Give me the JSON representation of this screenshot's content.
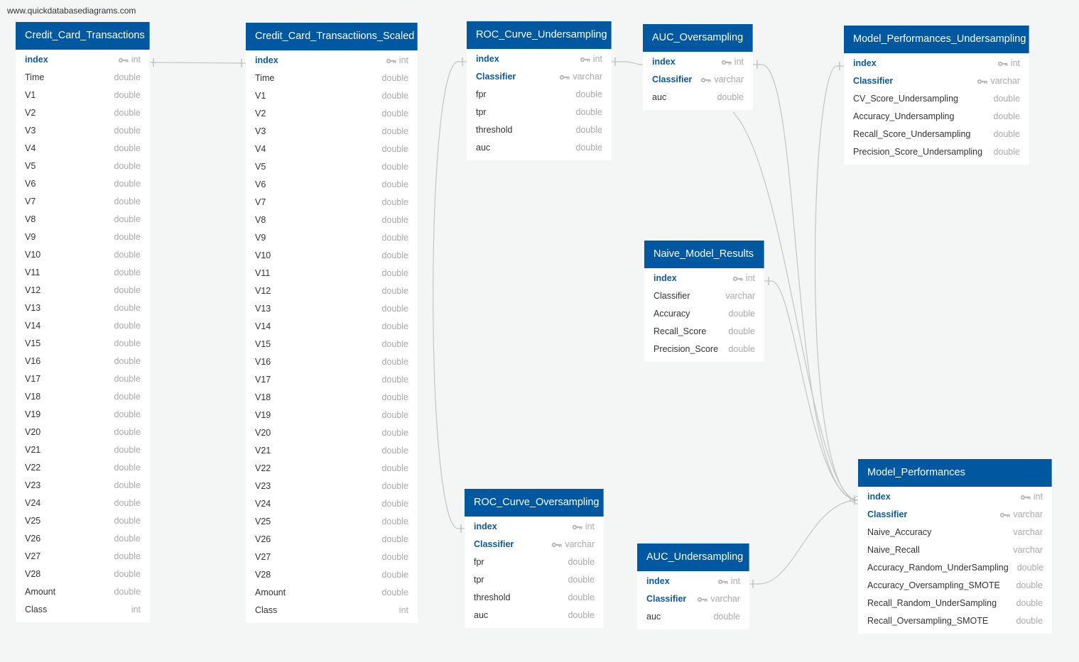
{
  "watermark": "www.quickdatabasediagrams.com",
  "tables": {
    "cct": {
      "name": "Credit_Card_Transactions",
      "fields": [
        {
          "name": "index",
          "type": "int",
          "pk": true
        },
        {
          "name": "Time",
          "type": "double"
        },
        {
          "name": "V1",
          "type": "double"
        },
        {
          "name": "V2",
          "type": "double"
        },
        {
          "name": "V3",
          "type": "double"
        },
        {
          "name": "V4",
          "type": "double"
        },
        {
          "name": "V5",
          "type": "double"
        },
        {
          "name": "V6",
          "type": "double"
        },
        {
          "name": "V7",
          "type": "double"
        },
        {
          "name": "V8",
          "type": "double"
        },
        {
          "name": "V9",
          "type": "double"
        },
        {
          "name": "V10",
          "type": "double"
        },
        {
          "name": "V11",
          "type": "double"
        },
        {
          "name": "V12",
          "type": "double"
        },
        {
          "name": "V13",
          "type": "double"
        },
        {
          "name": "V14",
          "type": "double"
        },
        {
          "name": "V15",
          "type": "double"
        },
        {
          "name": "V16",
          "type": "double"
        },
        {
          "name": "V17",
          "type": "double"
        },
        {
          "name": "V18",
          "type": "double"
        },
        {
          "name": "V19",
          "type": "double"
        },
        {
          "name": "V20",
          "type": "double"
        },
        {
          "name": "V21",
          "type": "double"
        },
        {
          "name": "V22",
          "type": "double"
        },
        {
          "name": "V23",
          "type": "double"
        },
        {
          "name": "V24",
          "type": "double"
        },
        {
          "name": "V25",
          "type": "double"
        },
        {
          "name": "V26",
          "type": "double"
        },
        {
          "name": "V27",
          "type": "double"
        },
        {
          "name": "V28",
          "type": "double"
        },
        {
          "name": "Amount",
          "type": "double"
        },
        {
          "name": "Class",
          "type": "int"
        }
      ]
    },
    "ccts": {
      "name": "Credit_Card_Transactiions_Scaled",
      "fields": [
        {
          "name": "index",
          "type": "int",
          "pk": true
        },
        {
          "name": "Time",
          "type": "double"
        },
        {
          "name": "V1",
          "type": "double"
        },
        {
          "name": "V2",
          "type": "double"
        },
        {
          "name": "V3",
          "type": "double"
        },
        {
          "name": "V4",
          "type": "double"
        },
        {
          "name": "V5",
          "type": "double"
        },
        {
          "name": "V6",
          "type": "double"
        },
        {
          "name": "V7",
          "type": "double"
        },
        {
          "name": "V8",
          "type": "double"
        },
        {
          "name": "V9",
          "type": "double"
        },
        {
          "name": "V10",
          "type": "double"
        },
        {
          "name": "V11",
          "type": "double"
        },
        {
          "name": "V12",
          "type": "double"
        },
        {
          "name": "V13",
          "type": "double"
        },
        {
          "name": "V14",
          "type": "double"
        },
        {
          "name": "V15",
          "type": "double"
        },
        {
          "name": "V16",
          "type": "double"
        },
        {
          "name": "V17",
          "type": "double"
        },
        {
          "name": "V18",
          "type": "double"
        },
        {
          "name": "V19",
          "type": "double"
        },
        {
          "name": "V20",
          "type": "double"
        },
        {
          "name": "V21",
          "type": "double"
        },
        {
          "name": "V22",
          "type": "double"
        },
        {
          "name": "V23",
          "type": "double"
        },
        {
          "name": "V24",
          "type": "double"
        },
        {
          "name": "V25",
          "type": "double"
        },
        {
          "name": "V26",
          "type": "double"
        },
        {
          "name": "V27",
          "type": "double"
        },
        {
          "name": "V28",
          "type": "double"
        },
        {
          "name": "Amount",
          "type": "double"
        },
        {
          "name": "Class",
          "type": "int"
        }
      ]
    },
    "rocu": {
      "name": "ROC_Curve_Undersampling",
      "fields": [
        {
          "name": "index",
          "type": "int",
          "pk": true
        },
        {
          "name": "Classifier",
          "type": "varchar",
          "pk": true
        },
        {
          "name": "fpr",
          "type": "double"
        },
        {
          "name": "tpr",
          "type": "double"
        },
        {
          "name": "threshold",
          "type": "double"
        },
        {
          "name": "auc",
          "type": "double"
        }
      ]
    },
    "auco": {
      "name": "AUC_Oversampling",
      "fields": [
        {
          "name": "index",
          "type": "int",
          "pk": true
        },
        {
          "name": "Classifier",
          "type": "varchar",
          "pk": true
        },
        {
          "name": "auc",
          "type": "double"
        }
      ]
    },
    "mpu": {
      "name": "Model_Performances_Undersampling",
      "fields": [
        {
          "name": "index",
          "type": "int",
          "pk": true
        },
        {
          "name": "Classifier",
          "type": "varchar",
          "pk": true
        },
        {
          "name": "CV_Score_Undersampling",
          "type": "double"
        },
        {
          "name": "Accuracy_Undersampling",
          "type": "double"
        },
        {
          "name": "Recall_Score_Undersampling",
          "type": "double"
        },
        {
          "name": "Precision_Score_Undersampling",
          "type": "double"
        }
      ]
    },
    "nmr": {
      "name": "Naive_Model_Results",
      "fields": [
        {
          "name": "index",
          "type": "int",
          "pk": true
        },
        {
          "name": "Classifier",
          "type": "varchar"
        },
        {
          "name": "Accuracy",
          "type": "double"
        },
        {
          "name": "Recall_Score",
          "type": "double"
        },
        {
          "name": "Precision_Score",
          "type": "double"
        }
      ]
    },
    "roco": {
      "name": "ROC_Curve_Oversampling",
      "fields": [
        {
          "name": "index",
          "type": "int",
          "pk": true
        },
        {
          "name": "Classifier",
          "type": "varchar",
          "pk": true
        },
        {
          "name": "fpr",
          "type": "double"
        },
        {
          "name": "tpr",
          "type": "double"
        },
        {
          "name": "threshold",
          "type": "double"
        },
        {
          "name": "auc",
          "type": "double"
        }
      ]
    },
    "aucu": {
      "name": "AUC_Undersampling",
      "fields": [
        {
          "name": "index",
          "type": "int",
          "pk": true
        },
        {
          "name": "Classifier",
          "type": "varchar",
          "pk": true
        },
        {
          "name": "auc",
          "type": "double"
        }
      ]
    },
    "mp": {
      "name": "Model_Performances",
      "fields": [
        {
          "name": "index",
          "type": "int",
          "pk": true
        },
        {
          "name": "Classifier",
          "type": "varchar",
          "pk": true
        },
        {
          "name": "Naive_Accuracy",
          "type": "varchar"
        },
        {
          "name": "Naive_Recall",
          "type": "varchar"
        },
        {
          "name": "Accuracy_Random_UnderSampling",
          "type": "double"
        },
        {
          "name": "Accuracy_Oversampling_SMOTE",
          "type": "double"
        },
        {
          "name": "Recall_Random_UnderSampling",
          "type": "double"
        },
        {
          "name": "Recall_Oversampling_SMOTE",
          "type": "double"
        }
      ]
    }
  },
  "relationships": [
    {
      "from": "Credit_Card_Transactions.index",
      "to": "Credit_Card_Transactiions_Scaled.index",
      "type": "one-to-one"
    },
    {
      "from": "ROC_Curve_Undersampling.index",
      "to": "ROC_Curve_Oversampling.index",
      "type": "one-to-one"
    },
    {
      "from": "ROC_Curve_Undersampling.index",
      "to": "AUC_Oversampling.index",
      "type": "one-to-one"
    },
    {
      "from": "AUC_Oversampling.index",
      "to": "Model_Performances.index",
      "type": "one-to-many"
    },
    {
      "from": "AUC_Oversampling.auc",
      "to": "Model_Performances.index",
      "type": "one-to-many"
    },
    {
      "from": "Model_Performances_Undersampling.index",
      "to": "Model_Performances.index",
      "type": "one-to-many"
    },
    {
      "from": "Naive_Model_Results.index",
      "to": "Model_Performances.index",
      "type": "one-to-many"
    },
    {
      "from": "AUC_Undersampling.index",
      "to": "Model_Performances.index",
      "type": "one-to-many"
    }
  ],
  "colors": {
    "header": "#0058a0",
    "pk_text": "#0a5a9c",
    "type_text": "#aaaaaa",
    "background": "#f4f5f5",
    "link": "#c4c4c4"
  }
}
